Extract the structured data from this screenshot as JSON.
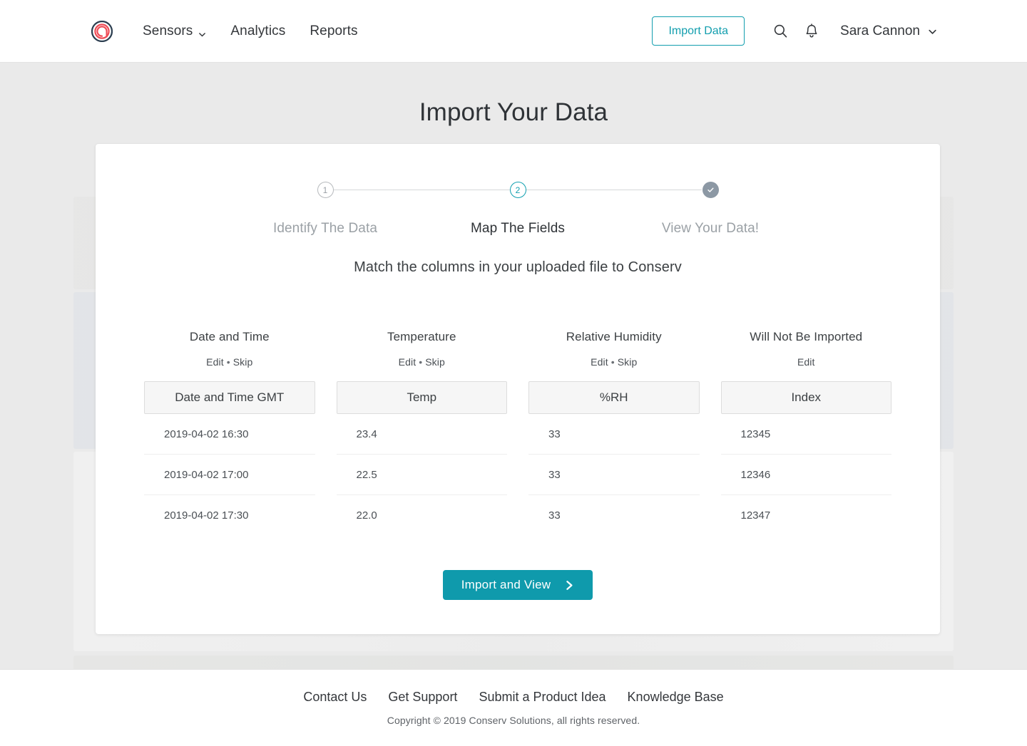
{
  "header": {
    "logo_icon": "conserv-spiral-logo-icon",
    "nav": [
      {
        "label": "Sensors",
        "has_caret": true
      },
      {
        "label": "Analytics",
        "has_caret": false
      },
      {
        "label": "Reports",
        "has_caret": false
      }
    ],
    "import_button": "Import Data",
    "search_icon": "search-icon",
    "bell_icon": "bell-icon",
    "user_name": "Sara Cannon",
    "user_caret_icon": "chevron-down-icon"
  },
  "page": {
    "title": "Import Your Data",
    "instruction": "Match the columns in your uploaded file to Conserv"
  },
  "stepper": {
    "steps": [
      {
        "marker": "1",
        "label": "Identify The Data",
        "state": "previous"
      },
      {
        "marker": "2",
        "label": "Map The Fields",
        "state": "current"
      },
      {
        "marker": "✓",
        "label": "View Your Data!",
        "state": "final"
      }
    ]
  },
  "mapping": {
    "columns": [
      {
        "title": "Date and Time",
        "edit_label": "Edit",
        "separator": "•",
        "skip_label": "Skip",
        "field_value": "Date and Time GMT",
        "values": [
          "2019-04-02 16:30",
          "2019-04-02 17:00",
          "2019-04-02 17:30"
        ]
      },
      {
        "title": "Temperature",
        "edit_label": "Edit",
        "separator": "•",
        "skip_label": "Skip",
        "field_value": "Temp",
        "values": [
          "23.4",
          "22.5",
          "22.0"
        ]
      },
      {
        "title": "Relative Humidity",
        "edit_label": "Edit",
        "separator": "•",
        "skip_label": "Skip",
        "field_value": "%RH",
        "values": [
          "33",
          "33",
          "33"
        ]
      },
      {
        "title": "Will Not Be Imported",
        "edit_label": "Edit",
        "separator": "",
        "skip_label": "",
        "field_value": "Index",
        "values": [
          "12345",
          "12346",
          "12347"
        ]
      }
    ],
    "submit_label": "Import and View",
    "submit_icon": "chevron-right-icon"
  },
  "footer": {
    "links": [
      "Contact Us",
      "Get Support",
      "Submit a Product Idea",
      "Knowledge Base"
    ],
    "copyright": "Copyright © 2019 Conserv Solutions, all rights reserved."
  },
  "colors": {
    "accent_teal": "#0f9aac",
    "logo_red": "#ef4b55",
    "logo_navy": "#2c3e50",
    "step_gray": "#8c98a4",
    "page_bg": "#eaeaea"
  }
}
